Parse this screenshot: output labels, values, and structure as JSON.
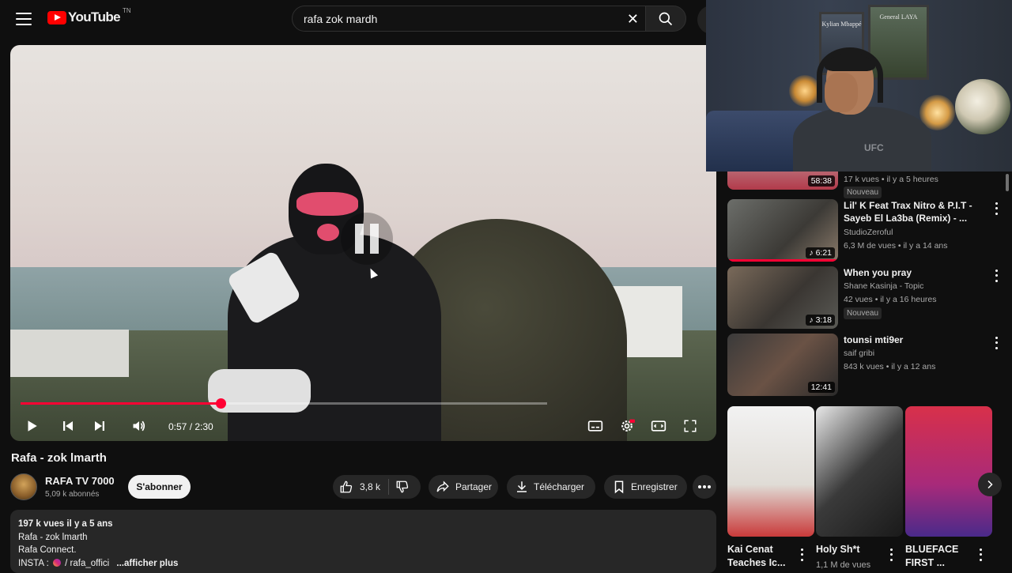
{
  "header": {
    "logo_text": "YouTube",
    "logo_region": "TN",
    "search_value": "rafa zok mardh"
  },
  "player": {
    "progress": 0.38,
    "buffered": 1.0,
    "time_current": "0:57",
    "time_total": "2:30",
    "time_label": "0:57 / 2:30",
    "state": "paused-overlay"
  },
  "video": {
    "title": "Rafa - zok lmarth",
    "channel_name": "RAFA TV 7000",
    "subscribers": "5,09 k abonnés",
    "subscribe_label": "S'abonner",
    "likes": "3,8 k",
    "share_label": "Partager",
    "download_label": "Télécharger",
    "save_label": "Enregistrer"
  },
  "description": {
    "stats": "197 k vues  il y a 5 ans",
    "line1": "Rafa - zok lmarth",
    "line2": "Rafa Connect.",
    "insta_prefix": "INSTA : ",
    "insta_handle": " / rafa_offici",
    "more_label": "...afficher plus"
  },
  "webcam": {
    "frame1_caption": "Kylian Mbappé",
    "frame2_caption": "General LAYA",
    "shirt_text": "UFC"
  },
  "sidebar": {
    "items": [
      {
        "duration": "58:38",
        "meta": "17 k vues • il y a 5 heures",
        "badge": "Nouveau"
      },
      {
        "title": "Lil' K Feat Trax Nitro & P.I.T - Sayeb El La3ba (Remix) - ...",
        "channel": "StudioZeroful",
        "meta": "6,3 M de vues • il y a 14 ans",
        "duration": "6:21",
        "music": "♪"
      },
      {
        "title": "When you pray",
        "channel": "Shane Kasinja - Topic",
        "meta": "42 vues • il y a 16 heures",
        "badge": "Nouveau",
        "duration": "3:18",
        "music": "♪"
      },
      {
        "title": "tounsi mti9er",
        "channel": "saif gribi",
        "meta": "843 k vues • il y a 12 ans",
        "duration": "12:41"
      }
    ],
    "shorts": [
      {
        "title": "Kai Cenat Teaches Ic...",
        "views": ""
      },
      {
        "title": "Holy Sh*t",
        "views": "1,1 M de vues"
      },
      {
        "title": "BLUEFACE FIRST ...",
        "views": ""
      }
    ]
  },
  "colors": {
    "accent": "#ff0033",
    "background": "#0f0f0f",
    "chip": "#272727"
  }
}
